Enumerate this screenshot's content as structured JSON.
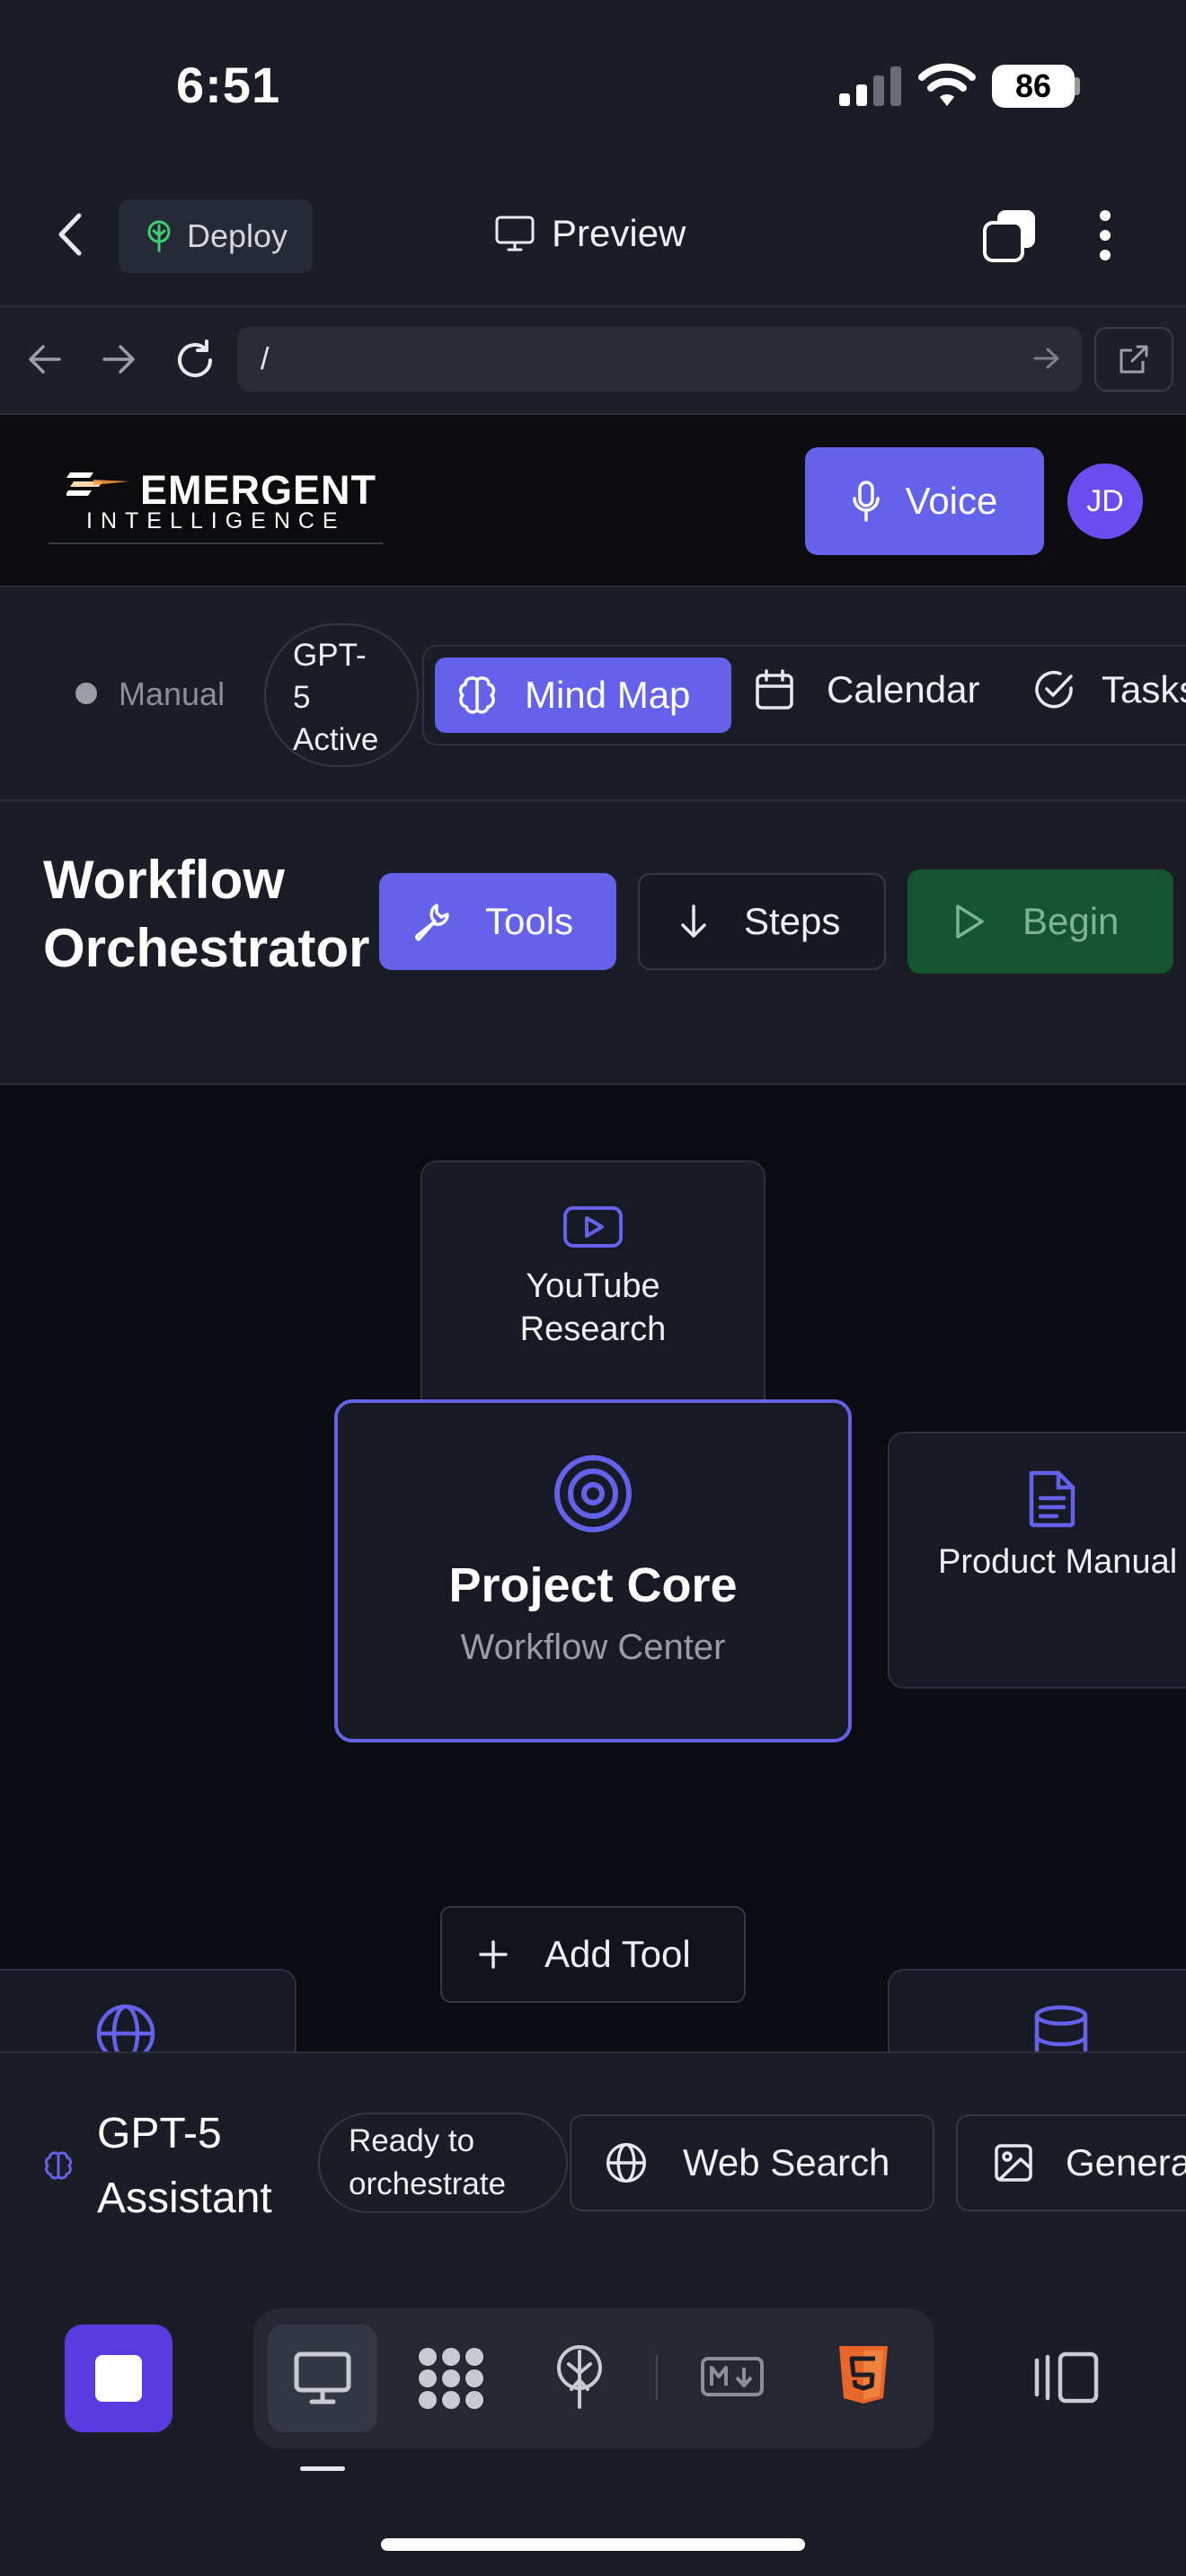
{
  "status_bar": {
    "time": "6:51",
    "battery": "86"
  },
  "header": {
    "deploy_label": "Deploy",
    "preview_label": "Preview"
  },
  "url_bar": {
    "url": "/"
  },
  "site": {
    "logo_main": "EMERGENT",
    "logo_sub": "INTELLIGENCE",
    "voice_label": "Voice",
    "avatar_initials": "JD"
  },
  "mode_bar": {
    "manual_label": "Manual",
    "model_badge": [
      "GPT-",
      "5",
      "Active"
    ],
    "tabs": [
      {
        "label": "Mind Map",
        "active": true
      },
      {
        "label": "Calendar",
        "active": false
      },
      {
        "label": "Tasks",
        "active": false
      }
    ]
  },
  "workflow": {
    "title_line1": "Workflow",
    "title_line2": "Orchestrator",
    "tools_label": "Tools",
    "steps_label": "Steps",
    "begin_label": "Begin"
  },
  "canvas": {
    "youtube_line1": "YouTube",
    "youtube_line2": "Research",
    "core_title": "Project Core",
    "core_subtitle": "Workflow Center",
    "manual_label": "Product Manual",
    "add_tool_label": "Add Tool"
  },
  "assistant": {
    "title_line1": "GPT-5",
    "title_line2": "Assistant",
    "status_line1": "Ready to",
    "status_line2": "orchestrate",
    "web_search_label": "Web Search",
    "generate_label": "Genera"
  },
  "colors": {
    "accent": "#6462ea",
    "background": "#1b1d26",
    "canvas": "#0b0c11",
    "begin_green": "#14552f",
    "html_orange": "#e8662a"
  }
}
